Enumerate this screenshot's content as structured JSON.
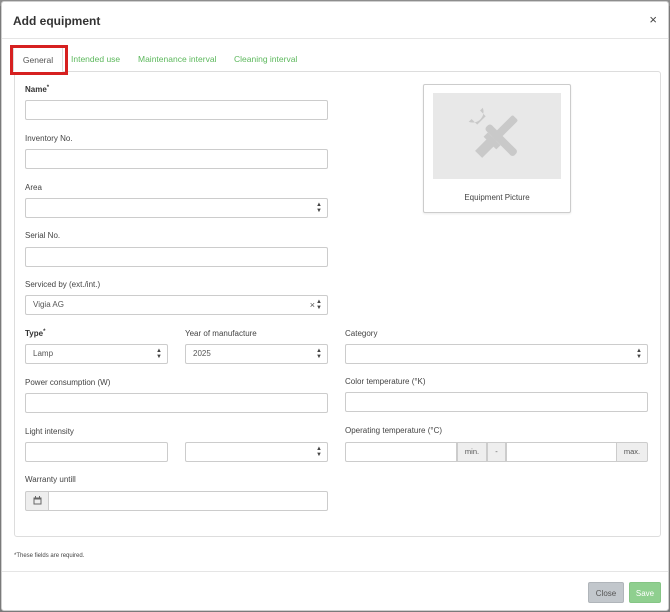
{
  "modal": {
    "title": "Add equipment",
    "close_symbol": "×"
  },
  "tabs": [
    {
      "label": "General",
      "active": true
    },
    {
      "label": "Intended use",
      "active": false
    },
    {
      "label": "Maintenance interval",
      "active": false
    },
    {
      "label": "Cleaning interval",
      "active": false
    }
  ],
  "form": {
    "name": {
      "label": "Name",
      "value": ""
    },
    "inventory_no": {
      "label": "Inventory No.",
      "value": ""
    },
    "area": {
      "label": "Area",
      "value": ""
    },
    "serial_no": {
      "label": "Serial No.",
      "value": ""
    },
    "serviced_by": {
      "label": "Serviced by (ext./int.)",
      "value": "Vigia AG",
      "clear_symbol": "×"
    },
    "type": {
      "label": "Type",
      "value": "Lamp"
    },
    "year_of_manufacture": {
      "label": "Year of manufacture",
      "value": "2025"
    },
    "category": {
      "label": "Category",
      "value": ""
    },
    "power_consumption": {
      "label": "Power consumption (W)",
      "value": ""
    },
    "color_temperature": {
      "label": "Color temperature (°K)",
      "value": ""
    },
    "light_intensity": {
      "label": "Light intensity",
      "value": "",
      "unit_value": ""
    },
    "operating_temperature": {
      "label": "Operating temperature (°C)",
      "min_label": "min.",
      "separator": "-",
      "max_label": "max.",
      "min_value": "",
      "max_value": ""
    },
    "warranty_until": {
      "label": "Warranty untill",
      "value": ""
    },
    "required_marker": "*"
  },
  "picture": {
    "caption": "Equipment Picture",
    "icon": "tools-icon"
  },
  "footnote": {
    "marker": "*",
    "text": "These fields are required."
  },
  "buttons": {
    "close": "Close",
    "save": "Save"
  },
  "colors": {
    "accent_green": "#5cb85c",
    "highlight_red": "#d62020",
    "save_green": "#8fcf8f",
    "close_gray": "#c2c7cc"
  }
}
